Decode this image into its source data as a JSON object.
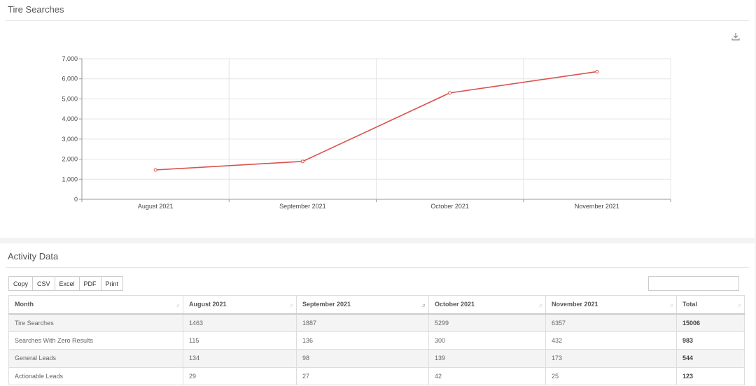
{
  "chart_panel": {
    "title": "Tire Searches",
    "download_icon": "download-icon"
  },
  "chart_data": {
    "type": "line",
    "categories": [
      "August 2021",
      "September 2021",
      "October 2021",
      "November 2021"
    ],
    "series": [
      {
        "values": [
          1463,
          1887,
          5299,
          6357
        ],
        "color": "#d9534f"
      }
    ],
    "ylim": [
      0,
      7000
    ],
    "yticks": [
      "0",
      "1,000",
      "2,000",
      "3,000",
      "4,000",
      "5,000",
      "6,000",
      "7,000"
    ],
    "grid": true
  },
  "table_panel": {
    "title": "Activity Data",
    "buttons": [
      "Copy",
      "CSV",
      "Excel",
      "PDF",
      "Print"
    ],
    "search_value": "",
    "columns": [
      "Month",
      "August 2021",
      "September 2021",
      "October 2021",
      "November 2021",
      "Total"
    ],
    "rows": [
      [
        "Tire Searches",
        "1463",
        "1887",
        "5299",
        "6357",
        "15006"
      ],
      [
        "Searches With Zero Results",
        "115",
        "136",
        "300",
        "432",
        "983"
      ],
      [
        "General Leads",
        "134",
        "98",
        "139",
        "173",
        "544"
      ],
      [
        "Actionable Leads",
        "29",
        "27",
        "42",
        "25",
        "123"
      ]
    ]
  }
}
